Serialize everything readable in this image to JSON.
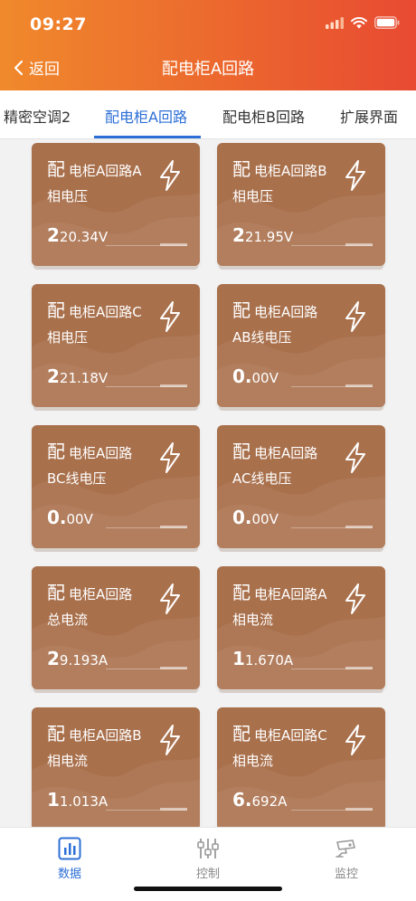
{
  "status": {
    "time": "09:27"
  },
  "nav": {
    "back_label": "返回",
    "title": "配电柜A回路"
  },
  "tabs": [
    "精密空调2",
    "配电柜A回路",
    "配电柜B回路",
    "扩展界面"
  ],
  "cards": [
    {
      "prefix": "配",
      "name": "电柜A回路A",
      "sub": "相电压",
      "lead": "2",
      "rest": "20.34V"
    },
    {
      "prefix": "配",
      "name": "电柜A回路B",
      "sub": "相电压",
      "lead": "2",
      "rest": "21.95V"
    },
    {
      "prefix": "配",
      "name": "电柜A回路C",
      "sub": "相电压",
      "lead": "2",
      "rest": "21.18V"
    },
    {
      "prefix": "配",
      "name": "电柜A回路",
      "sub": "AB线电压",
      "lead": "0.",
      "rest": "00V"
    },
    {
      "prefix": "配",
      "name": "电柜A回路",
      "sub": "BC线电压",
      "lead": "0.",
      "rest": "00V"
    },
    {
      "prefix": "配",
      "name": "电柜A回路",
      "sub": "AC线电压",
      "lead": "0.",
      "rest": "00V"
    },
    {
      "prefix": "配",
      "name": "电柜A回路",
      "sub": "总电流",
      "lead": "2",
      "rest": "9.193A"
    },
    {
      "prefix": "配",
      "name": "电柜A回路A",
      "sub": "相电流",
      "lead": "1",
      "rest": "1.670A"
    },
    {
      "prefix": "配",
      "name": "电柜A回路B",
      "sub": "相电流",
      "lead": "1",
      "rest": "1.013A"
    },
    {
      "prefix": "配",
      "name": "电柜A回路C",
      "sub": "相电流",
      "lead": "6.",
      "rest": "692A"
    }
  ],
  "bottom_nav": {
    "data_label": "数据",
    "control_label": "控制",
    "monitor_label": "监控"
  },
  "colors": {
    "accent": "#2d6fd6",
    "card": "#a9704c",
    "header_start": "#f0892c",
    "header_end": "#e84a32"
  }
}
